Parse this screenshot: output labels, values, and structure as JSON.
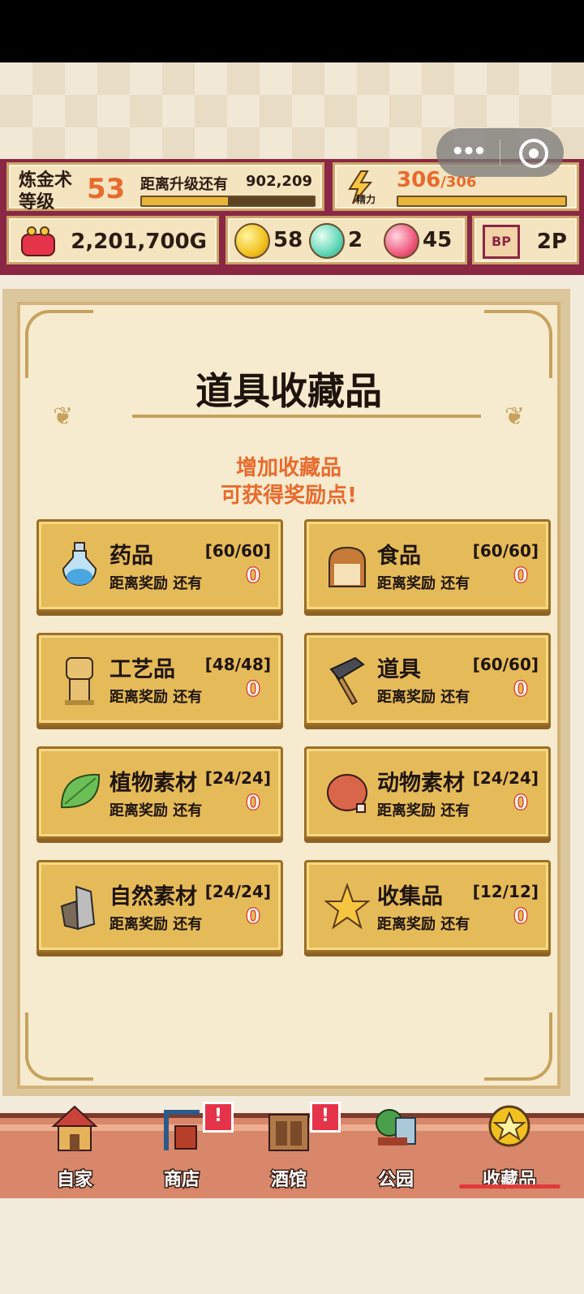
{
  "header": {
    "level_label": "炼金术\n等级",
    "level": "53",
    "next_label": "距离升级还有",
    "next_value": "902,209",
    "next_progress": 0.5,
    "energy_label": "精力",
    "energy_current": "306",
    "energy_max": "/306",
    "energy_progress": 1.0
  },
  "currency": {
    "gold": "2,201,700G",
    "yellow_gems": "58",
    "blue_gems": "2",
    "pink_gems": "45",
    "bp_label": "BP",
    "bp_value": "2P"
  },
  "page": {
    "title": "道具收藏品",
    "subtitle_line1": "增加收藏品",
    "subtitle_line2": "可获得奖励点!"
  },
  "categories": [
    {
      "name": "药品",
      "count": "[60/60]",
      "reward_label": "距离奖励 还有",
      "reward_value": "0",
      "icon": "potion-icon"
    },
    {
      "name": "食品",
      "count": "[60/60]",
      "reward_label": "距离奖励 还有",
      "reward_value": "0",
      "icon": "bread-icon"
    },
    {
      "name": "工艺品",
      "count": "[48/48]",
      "reward_label": "距离奖励 还有",
      "reward_value": "0",
      "icon": "statue-icon"
    },
    {
      "name": "道具",
      "count": "[60/60]",
      "reward_label": "距离奖励 还有",
      "reward_value": "0",
      "icon": "hammer-icon"
    },
    {
      "name": "植物素材",
      "count": "[24/24]",
      "reward_label": "距离奖励 还有",
      "reward_value": "0",
      "icon": "leaf-icon"
    },
    {
      "name": "动物素材",
      "count": "[24/24]",
      "reward_label": "距离奖励 还有",
      "reward_value": "0",
      "icon": "meat-icon"
    },
    {
      "name": "自然素材",
      "count": "[24/24]",
      "reward_label": "距离奖励 还有",
      "reward_value": "0",
      "icon": "stone-icon"
    },
    {
      "name": "收集品",
      "count": "[12/12]",
      "reward_label": "距离奖励 还有",
      "reward_value": "0",
      "icon": "star-icon"
    }
  ],
  "nav": [
    {
      "label": "自家",
      "icon": "house-icon",
      "alert": false
    },
    {
      "label": "商店",
      "icon": "shop-icon",
      "alert": true
    },
    {
      "label": "酒馆",
      "icon": "tavern-icon",
      "alert": true
    },
    {
      "label": "公园",
      "icon": "park-icon",
      "alert": false
    },
    {
      "label": "收藏品",
      "icon": "collection-icon",
      "alert": false,
      "active": true
    }
  ],
  "alert_glyph": "!",
  "colors": {
    "accent": "#e86a2d",
    "hud_bg": "#8a2744",
    "tile": "#e5bb59",
    "nav_bg": "#d8876a"
  }
}
